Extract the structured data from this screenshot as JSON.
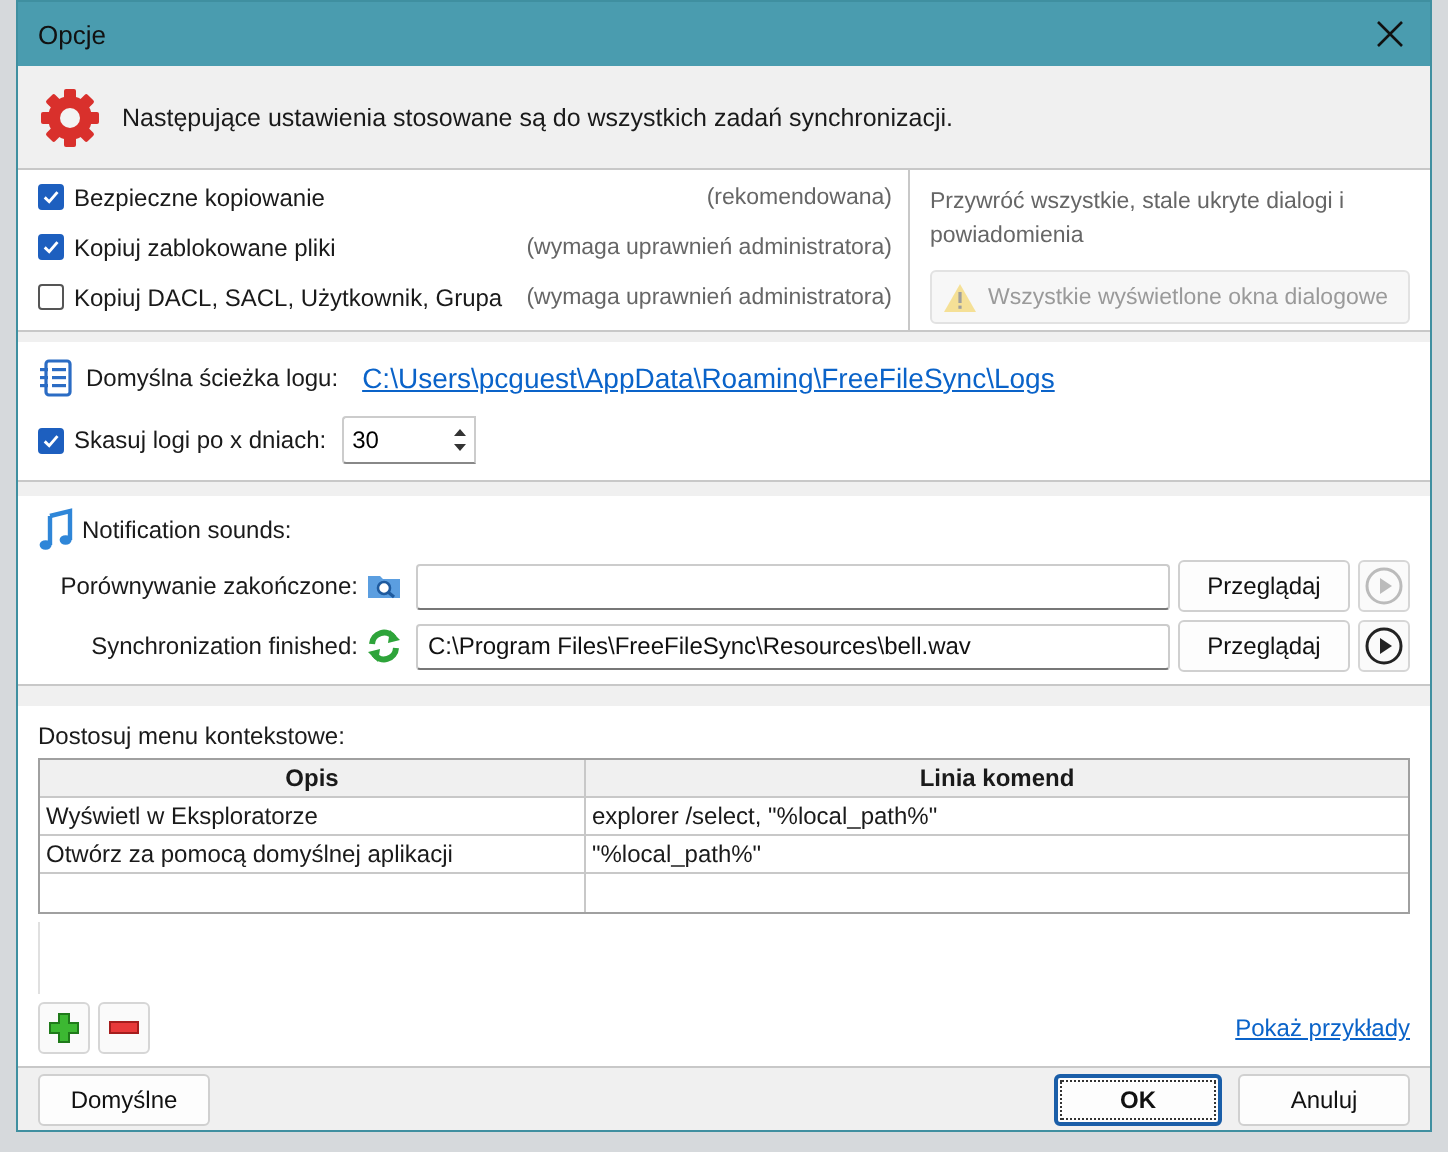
{
  "window": {
    "title": "Opcje"
  },
  "header": {
    "text": "Następujące ustawienia stosowane są do wszystkich zadań synchronizacji."
  },
  "copy_options": [
    {
      "label": "Bezpieczne kopiowanie",
      "note": "(rekomendowana)",
      "checked": true
    },
    {
      "label": "Kopiuj zablokowane pliki",
      "note": "(wymaga uprawnień administratora)",
      "checked": true
    },
    {
      "label": "Kopiuj DACL, SACL, Użytkownik, Grupa",
      "note": "(wymaga uprawnień administratora)",
      "checked": false
    }
  ],
  "dialogs": {
    "text": "Przywróć wszystkie, stale ukryte dialogi i powiadomienia",
    "button": {
      "label": "Wszystkie wyświetlone okna dialogowe",
      "disabled": true
    }
  },
  "log": {
    "label": "Domyślna ścieżka logu:",
    "path": "C:\\Users\\pcguest\\AppData\\Roaming\\FreeFileSync\\Logs",
    "delete": {
      "label": "Skasuj logi po x dniach:",
      "checked": true,
      "value": "30"
    }
  },
  "sounds": {
    "title": "Notification sounds:",
    "items": [
      {
        "kind": "compare",
        "label": "Porównywanie zakończone:",
        "browse": "Przeglądaj",
        "playable": false
      },
      {
        "kind": "sync",
        "label": "Synchronization finished:",
        "value": "C:\\Program Files\\FreeFileSync\\Resources\\bell.wav",
        "browse": "Przeglądaj",
        "playable": true
      }
    ]
  },
  "context_menu": {
    "title": "Dostosuj menu kontekstowe:",
    "columns": [
      "Opis",
      "Linia komend"
    ],
    "rows": [
      [
        "Wyświetl w Eksploratorze",
        "explorer /select, \"%local_path%\""
      ],
      [
        "Otwórz za pomocą domyślnej aplikacji",
        "\"%local_path%\""
      ]
    ],
    "link": "Pokaż przykłady"
  },
  "buttons": {
    "defaults": "Domyślne",
    "ok": "OK",
    "cancel": "Anuluj"
  }
}
